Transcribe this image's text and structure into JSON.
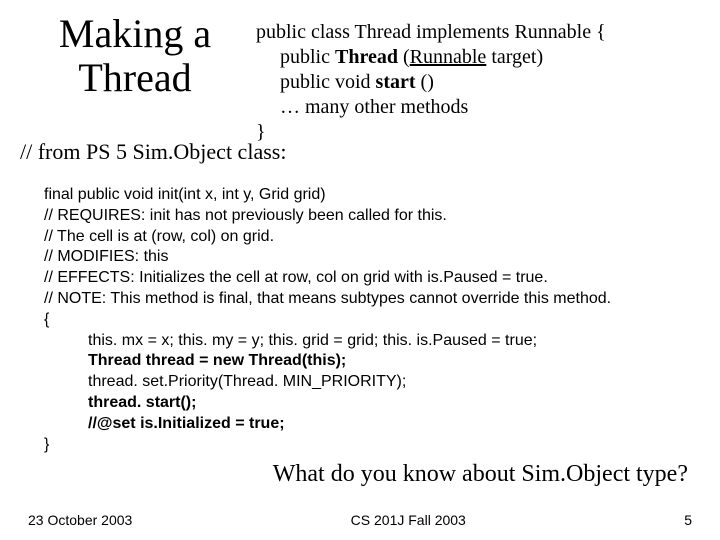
{
  "title": "Making a Thread",
  "classdef": {
    "l1a": "public class Thread implements Runnable {",
    "l2a": "public ",
    "l2b": "Thread ",
    "l2c": "(",
    "l2d": "Runnable",
    "l2e": " target)",
    "l3a": "public void ",
    "l3b": "start ",
    "l3c": "()",
    "l4": "… many other methods",
    "l5": "}"
  },
  "from": "// from PS 5 Sim.Object class:",
  "code": {
    "sig": "final public void init(int x, int y, Grid grid)",
    "c1": "// REQUIRES: init has not previously been called for this.",
    "c2": "//     The cell is at (row, col) on grid.",
    "c3": "// MODIFIES: this",
    "c4": "// EFFECTS: Initializes the cell at row, col on grid with is.Paused = true.",
    "c5": "//   NOTE: This method is final, that means subtypes cannot override this method.",
    "ob": "{",
    "b1": "this. mx = x;  this. my = y; this. grid = grid;  this. is.Paused = true;",
    "b2": "Thread thread = new Thread(this);",
    "b3": "thread. set.Priority(Thread. MIN_PRIORITY);",
    "b4": "thread. start();",
    "b5": "//@set is.Initialized = true;",
    "cb": "}"
  },
  "question": "What do you know about Sim.Object type?",
  "footer": {
    "left": "23 October 2003",
    "center": "CS 201J Fall 2003",
    "right": "5"
  }
}
